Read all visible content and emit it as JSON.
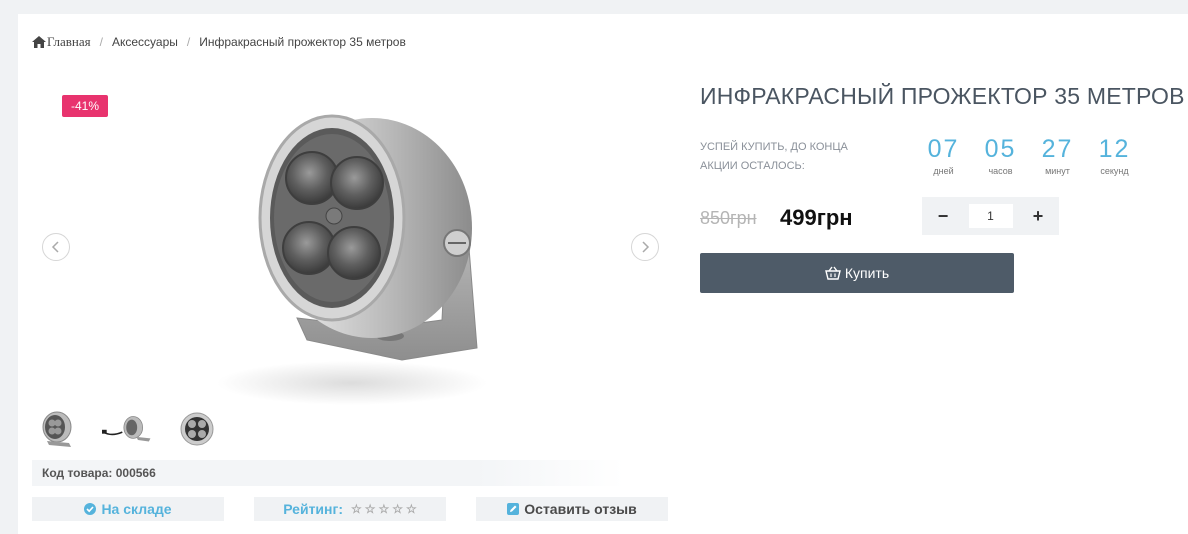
{
  "breadcrumb": {
    "home": "Главная",
    "items": [
      "Аксессуары",
      "Инфракрасный прожектор 35 метров"
    ],
    "separator": "/"
  },
  "gallery": {
    "discount_badge": "-41%",
    "prev_icon": "chevron-left-icon",
    "next_icon": "chevron-right-icon",
    "thumbnails": [
      "ir-spotlight-front",
      "ir-spotlight-with-cable",
      "ir-spotlight-face"
    ]
  },
  "product": {
    "title": "ИНФРАКРАСНЫЙ ПРОЖЕКТОР 35 МЕТРОВ",
    "sku_label": "Код товара: 000566",
    "old_price": "850грн",
    "price": "499грн"
  },
  "promo": {
    "text": "Успей купить, до конца акции осталось:",
    "timer": [
      {
        "value": "07",
        "label": "дней"
      },
      {
        "value": "05",
        "label": "часов"
      },
      {
        "value": "27",
        "label": "минут"
      },
      {
        "value": "12",
        "label": "секунд"
      }
    ]
  },
  "quantity": {
    "minus": "−",
    "value": "1",
    "plus": "+"
  },
  "buy_button": {
    "label": "Купить",
    "icon": "basket-icon"
  },
  "actions": {
    "stock": "На складе",
    "rating_label": "Рейтинг:",
    "rating_stars": 0,
    "rating_max": 5,
    "review": "Оставить отзыв"
  },
  "colors": {
    "accent": "#55b3dc",
    "badge": "#e8336e",
    "buy_button": "#4e5b68",
    "title": "#4a5561"
  }
}
